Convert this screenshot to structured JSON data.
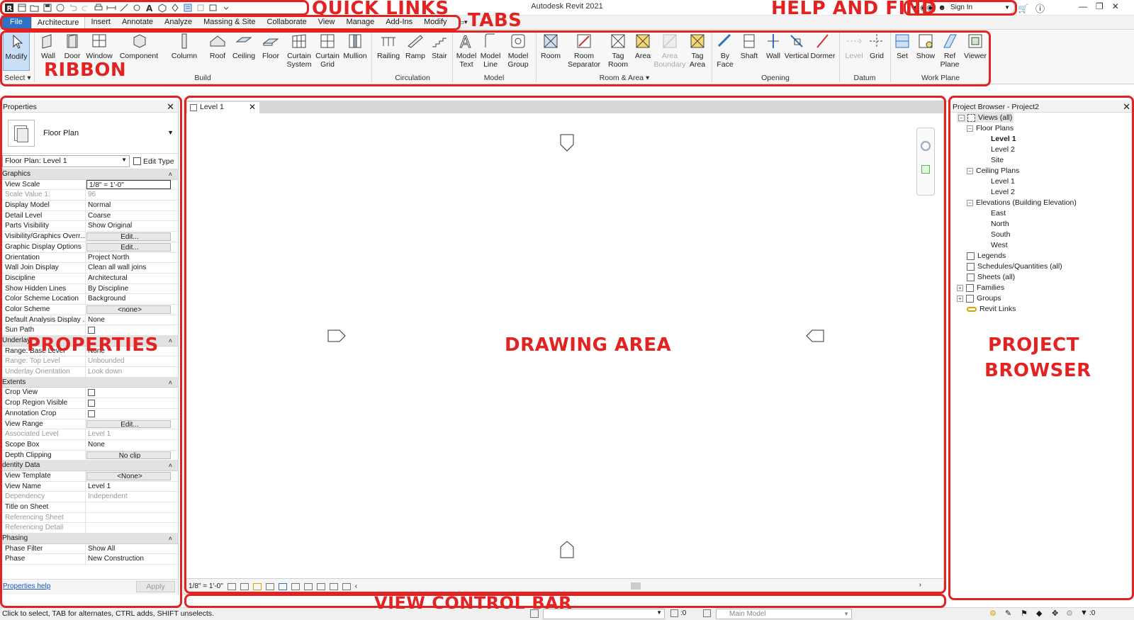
{
  "window": {
    "title": "Autodesk Revit 2021",
    "sign_in": "Sign In",
    "controls": [
      "—",
      "❐",
      "✕"
    ]
  },
  "tabs": [
    {
      "label": "File"
    },
    {
      "label": "Architecture"
    },
    {
      "label": "Insert"
    },
    {
      "label": "Annotate"
    },
    {
      "label": "Analyze"
    },
    {
      "label": "Massing & Site"
    },
    {
      "label": "Collaborate"
    },
    {
      "label": "View"
    },
    {
      "label": "Manage"
    },
    {
      "label": "Add-Ins"
    },
    {
      "label": "Modify"
    }
  ],
  "ribbon": {
    "select_label": "Select",
    "buttons": {
      "modify": "Modify",
      "wall": "Wall",
      "door": "Door",
      "window": "Window",
      "component": "Component",
      "column": "Column",
      "roof": "Roof",
      "ceiling": "Ceiling",
      "floor": "Floor",
      "curtain_system": "Curtain System",
      "curtain_grid": "Curtain Grid",
      "mullion": "Mullion",
      "railing": "Railing",
      "ramp": "Ramp",
      "stair": "Stair",
      "model_text": "Model Text",
      "model_line": "Model Line",
      "model_group": "Model Group",
      "room": "Room",
      "room_separator": "Room Separator",
      "tag_room": "Tag Room",
      "area": "Area",
      "area_boundary": "Area Boundary",
      "tag_area": "Tag Area",
      "by_face": "By Face",
      "shaft": "Shaft",
      "wall_opening": "Wall",
      "vertical": "Vertical",
      "dormer": "Dormer",
      "level": "Level",
      "grid": "Grid",
      "set": "Set",
      "show": "Show",
      "ref_plane": "Ref Plane",
      "viewer": "Viewer"
    },
    "panels": {
      "build": "Build",
      "circulation": "Circulation",
      "model": "Model",
      "room_area": "Room & Area",
      "opening": "Opening",
      "datum": "Datum",
      "work_plane": "Work Plane"
    }
  },
  "properties": {
    "title": "Properties",
    "type_name": "Floor Plan",
    "instance": "Floor Plan: Level 1",
    "edit_type": "Edit Type",
    "groups": {
      "graphics": "Graphics",
      "underlay": "Underlay",
      "extents": "Extents",
      "identity": "dentity Data",
      "phasing": "Phasing"
    },
    "rows": {
      "view_scale": {
        "k": "View Scale",
        "v": "1/8\" = 1'-0\""
      },
      "scale_value": {
        "k": "Scale Value    1:",
        "v": "96"
      },
      "display_model": {
        "k": "Display Model",
        "v": "Normal"
      },
      "detail_level": {
        "k": "Detail Level",
        "v": "Coarse"
      },
      "parts_visibility": {
        "k": "Parts Visibility",
        "v": "Show Original"
      },
      "vis_graphics": {
        "k": "Visibility/Graphics Overr...",
        "v": "Edit..."
      },
      "graphic_display": {
        "k": "Graphic Display Options",
        "v": "Edit..."
      },
      "orientation": {
        "k": "Orientation",
        "v": "Project North"
      },
      "wall_join": {
        "k": "Wall Join Display",
        "v": "Clean all wall joins"
      },
      "discipline": {
        "k": "Discipline",
        "v": "Architectural"
      },
      "hidden_lines": {
        "k": "Show Hidden Lines",
        "v": "By Discipline"
      },
      "color_scheme_loc": {
        "k": "Color Scheme Location",
        "v": "Background"
      },
      "color_scheme": {
        "k": "Color Scheme",
        "v": "<none>"
      },
      "default_analysis": {
        "k": "Default Analysis Display ...",
        "v": "None"
      },
      "sun_path": {
        "k": "Sun Path",
        "v": ""
      },
      "base_level": {
        "k": "Range: Base Level",
        "v": "None"
      },
      "top_level": {
        "k": "Range: Top Level",
        "v": "Unbounded"
      },
      "underlay_orient": {
        "k": "Underlay Orientation",
        "v": "Look down"
      },
      "crop_view": {
        "k": "Crop View",
        "v": ""
      },
      "crop_region": {
        "k": "Crop Region Visible",
        "v": ""
      },
      "annotation_crop": {
        "k": "Annotation Crop",
        "v": ""
      },
      "view_range": {
        "k": "View Range",
        "v": "Edit..."
      },
      "assoc_level": {
        "k": "Associated Level",
        "v": "Level 1"
      },
      "scope_box": {
        "k": "Scope Box",
        "v": "None"
      },
      "depth_clipping": {
        "k": "Depth Clipping",
        "v": "No clip"
      },
      "view_template": {
        "k": "View Template",
        "v": "<None>"
      },
      "view_name": {
        "k": "View Name",
        "v": "Level 1"
      },
      "dependency": {
        "k": "Dependency",
        "v": "Independent"
      },
      "title_on_sheet": {
        "k": "Title on Sheet",
        "v": ""
      },
      "ref_sheet": {
        "k": "Referencing Sheet",
        "v": ""
      },
      "ref_detail": {
        "k": "Referencing Detail",
        "v": ""
      },
      "phase_filter": {
        "k": "Phase Filter",
        "v": "Show All"
      },
      "phase": {
        "k": "Phase",
        "v": "New Construction"
      }
    },
    "help_link": "Properties help",
    "apply": "Apply"
  },
  "drawing": {
    "view_tab": "Level 1",
    "scale": "1/8\" = 1'-0\""
  },
  "browser": {
    "title": "Project Browser - Project2",
    "items": {
      "views_all": "Views (all)",
      "floor_plans": "Floor Plans",
      "fp_level1": "Level 1",
      "fp_level2": "Level 2",
      "fp_site": "Site",
      "ceiling_plans": "Ceiling Plans",
      "cp_level1": "Level 1",
      "cp_level2": "Level 2",
      "elevations": "Elevations (Building Elevation)",
      "east": "East",
      "north": "North",
      "south": "South",
      "west": "West",
      "legends": "Legends",
      "schedules": "Schedules/Quantities (all)",
      "sheets": "Sheets (all)",
      "families": "Families",
      "groups": "Groups",
      "revit_links": "Revit Links"
    }
  },
  "status": {
    "hint": "Click to select, TAB for alternates, CTRL adds, SHIFT unselects.",
    "count": ":0",
    "model": "Main Model",
    "filter_count": ":0"
  },
  "annotations": {
    "quick_links": "QUICK LINKS",
    "tabs": "TABS",
    "help_find": "HELP AND FIND",
    "ribbon": "RIBBON",
    "properties": "PROPERTIES",
    "drawing_area": "DRAWING AREA",
    "project_browser_1": "PROJECT",
    "project_browser_2": "BROWSER",
    "view_control_bar": "VIEW CONTROL BAR"
  },
  "colors": {
    "annotation": "#e32222",
    "file_tab": "#2f72c2",
    "link": "#1b55c2"
  }
}
